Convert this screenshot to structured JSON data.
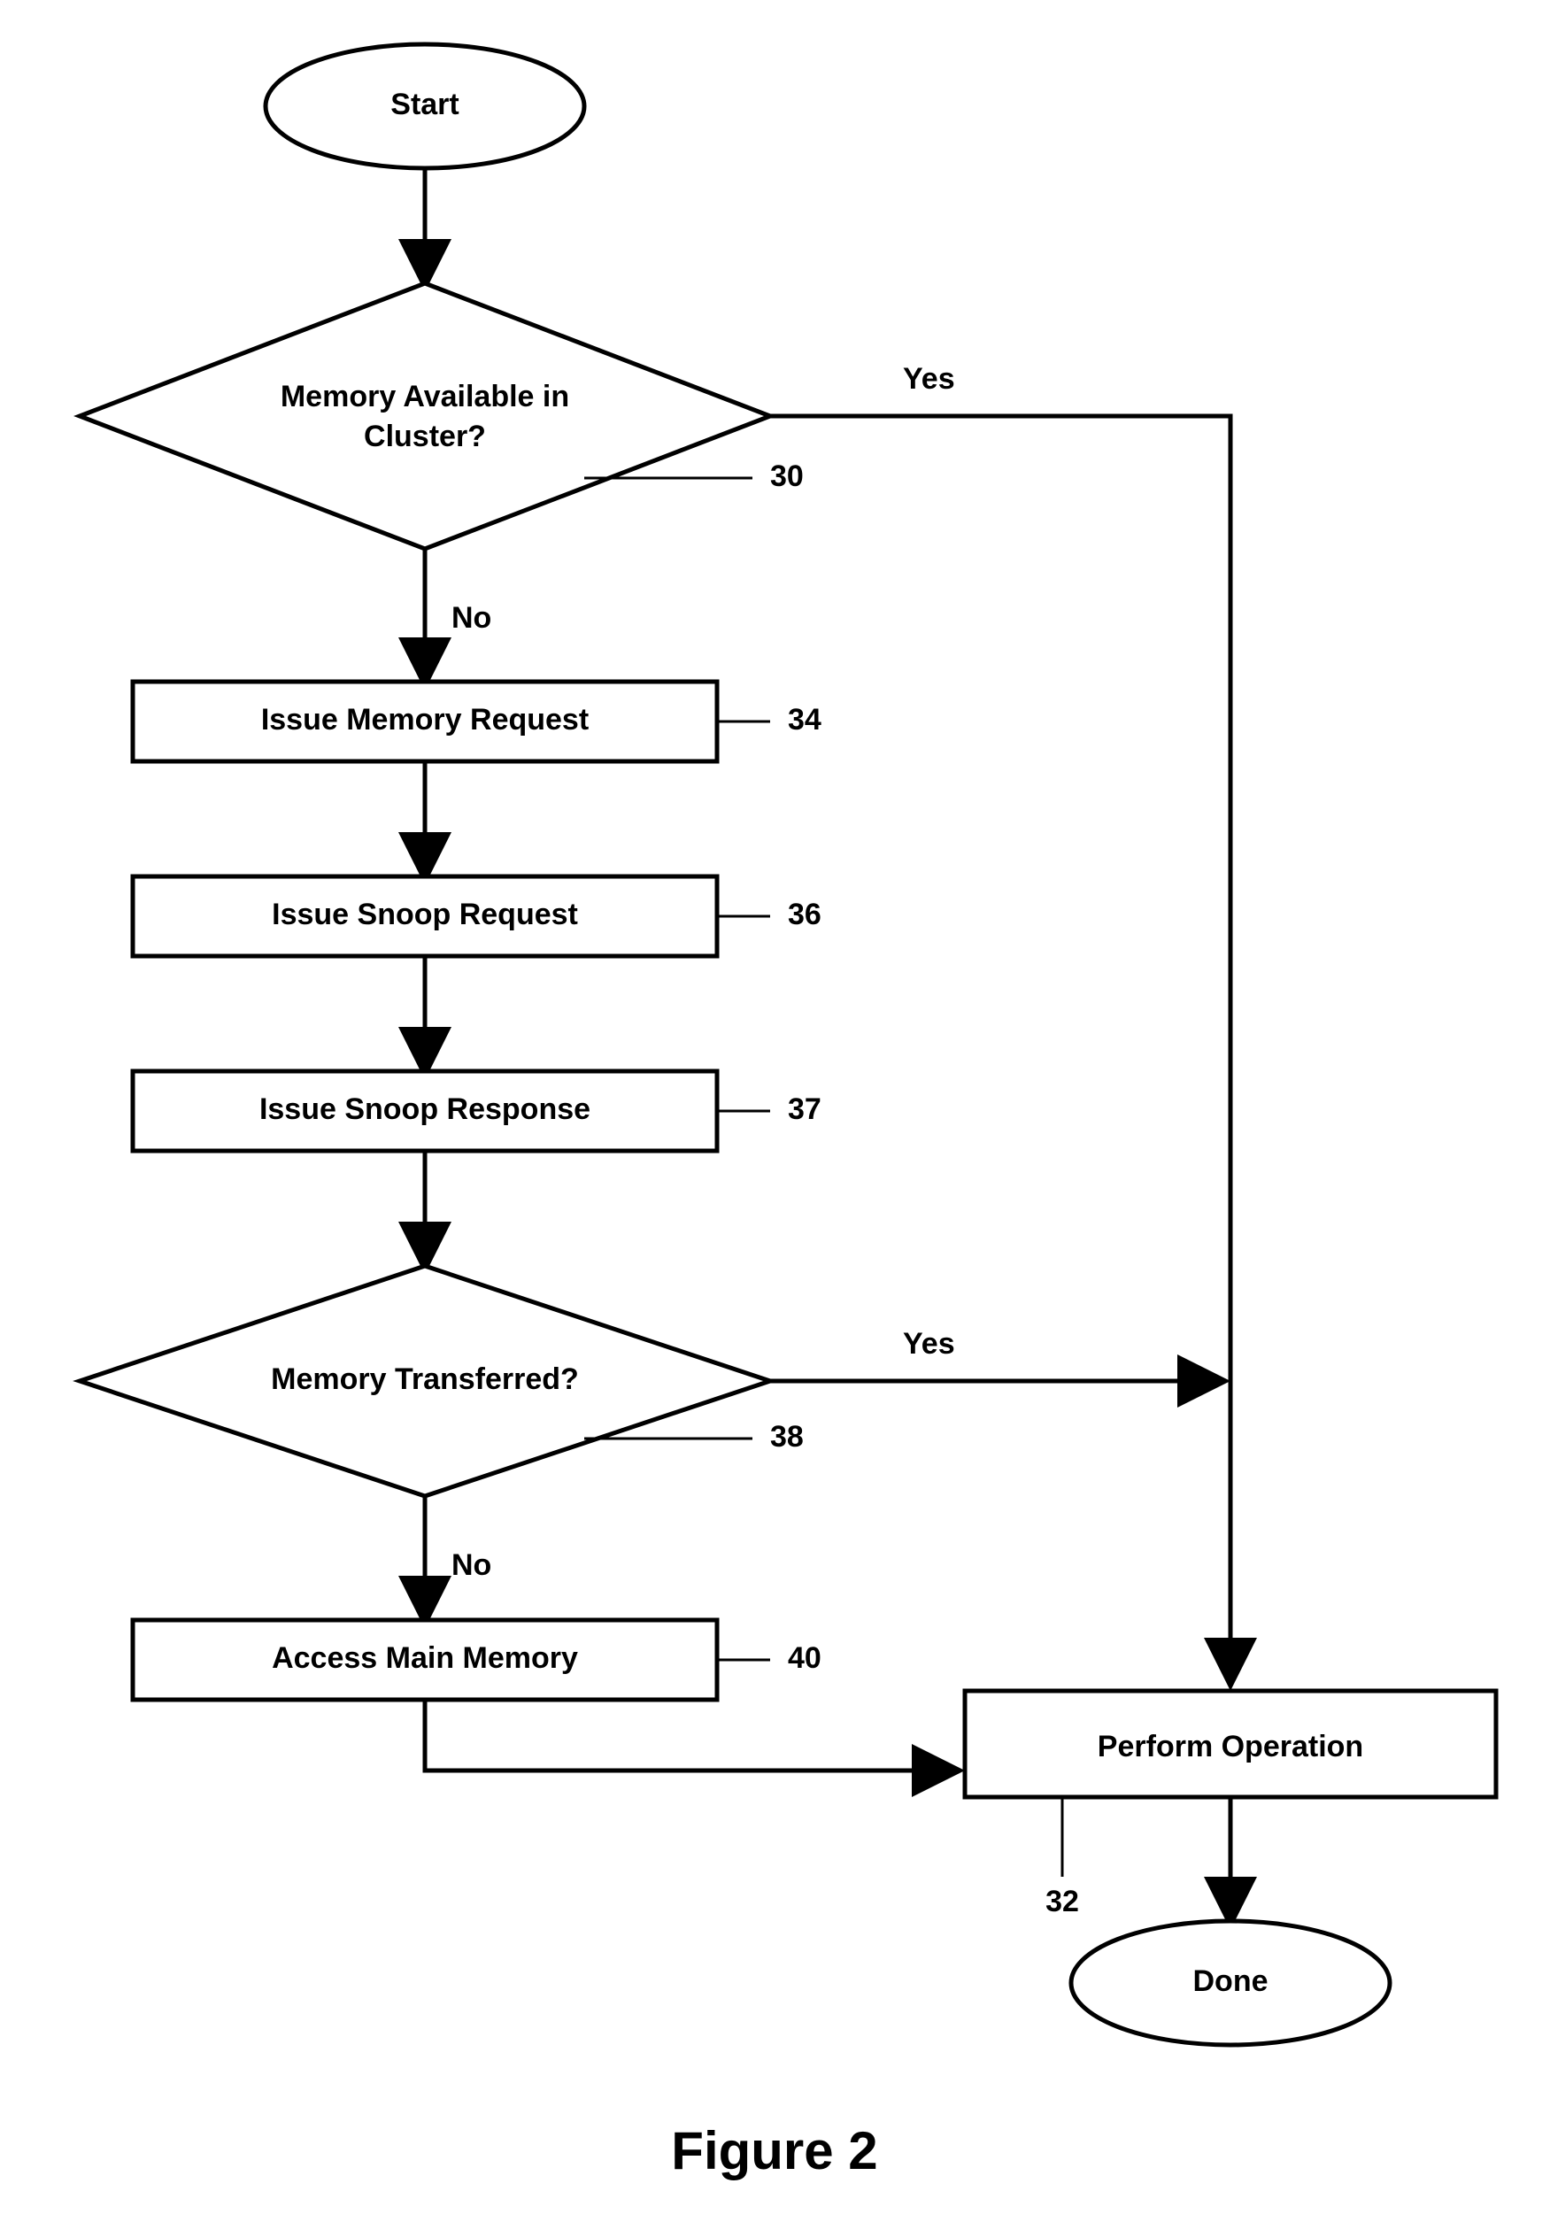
{
  "figure_caption": "Figure 2",
  "nodes": {
    "start": "Start",
    "done": "Done",
    "decision_mem_avail_l1": "Memory Available in",
    "decision_mem_avail_l2": "Cluster?",
    "decision_transferred": "Memory Transferred?",
    "issue_mem_req": "Issue Memory Request",
    "issue_snoop_req": "Issue Snoop Request",
    "issue_snoop_resp": "Issue Snoop Response",
    "access_main_mem": "Access Main Memory",
    "perform_op": "Perform Operation"
  },
  "edge_labels": {
    "yes": "Yes",
    "no": "No"
  },
  "refs": {
    "r30": "30",
    "r32": "32",
    "r34": "34",
    "r36": "36",
    "r37": "37",
    "r38": "38",
    "r40": "40"
  }
}
